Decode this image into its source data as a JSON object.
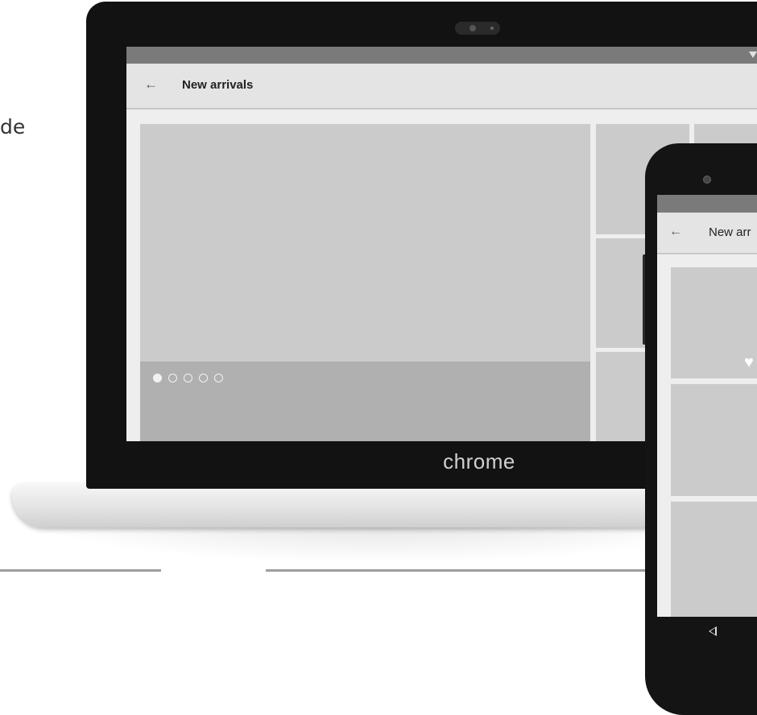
{
  "side_text": "de",
  "laptop": {
    "brand_label": "chrome",
    "app": {
      "toolbar_title": "New arrivals",
      "back_icon": "arrow-left-icon",
      "carousel": {
        "page_count": 5,
        "active_index": 0
      }
    }
  },
  "phone": {
    "app": {
      "toolbar_title": "New arr",
      "back_icon": "arrow-left-icon",
      "favorite_icon": "heart-icon"
    },
    "nav": {
      "back_icon": "nav-back-triangle-icon"
    }
  },
  "colors": {
    "placeholder_tile": "#cbcbcb",
    "caption": "#b0b0b0",
    "status_bar": "#7a7a7a",
    "toolbar": "#e4e4e4",
    "bezel": "#121212"
  }
}
